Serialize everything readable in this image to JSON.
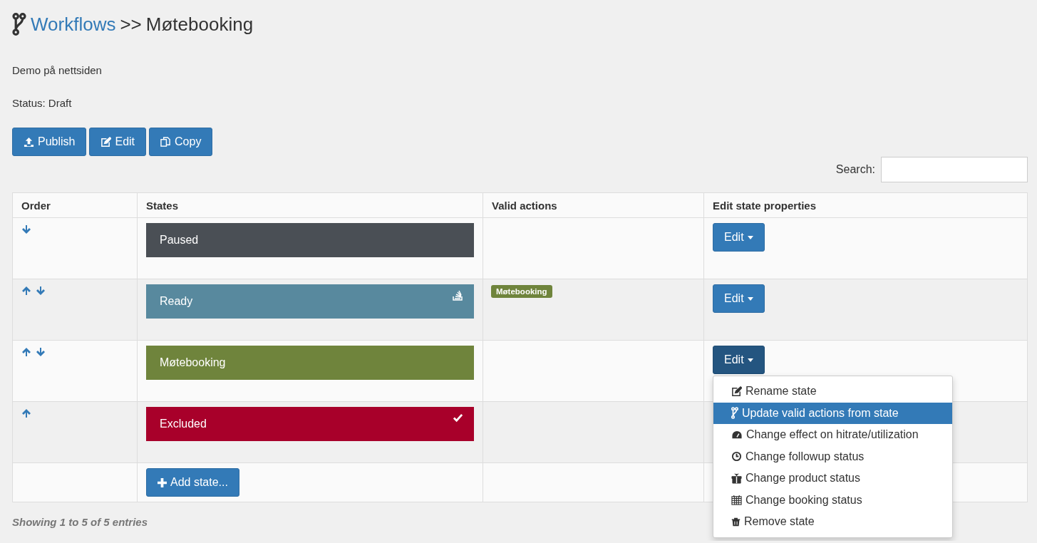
{
  "header": {
    "link": "Workflows",
    "separator": ">>",
    "title": "Møtebooking"
  },
  "description": "Demo på nettsiden",
  "status": "Status: Draft",
  "actions": [
    "Publish",
    "Edit",
    "Copy"
  ],
  "search": {
    "label": "Search:"
  },
  "table": {
    "columns": [
      "Order",
      "States",
      "Valid actions",
      "Edit state properties"
    ],
    "rows": [
      {
        "up": false,
        "down": true,
        "state": "Paused",
        "color": "#4a4f55",
        "kind": "plain",
        "actions": [],
        "edit": "Edit",
        "open": false
      },
      {
        "up": true,
        "down": true,
        "state": "Ready",
        "color": "#58899e",
        "kind": "start",
        "actions": [
          {
            "label": "Møtebooking",
            "color": "#6f843c"
          }
        ],
        "edit": "Edit",
        "open": false
      },
      {
        "up": true,
        "down": true,
        "state": "Møtebooking",
        "color": "#6f843c",
        "kind": "plain",
        "actions": [],
        "edit": "Edit",
        "open": true
      },
      {
        "up": true,
        "down": false,
        "state": "Excluded",
        "color": "#a8002a",
        "kind": "final",
        "actions": [],
        "open": false
      }
    ],
    "add_button": "Add state..."
  },
  "menu": [
    {
      "label": "Rename state",
      "selected": false
    },
    {
      "label": "Update valid actions from state",
      "selected": true
    },
    {
      "label": "Change effect on hitrate/utilization",
      "selected": false
    },
    {
      "label": "Change followup status",
      "selected": false
    },
    {
      "label": "Change product status",
      "selected": false
    },
    {
      "label": "Change booking status",
      "selected": false
    },
    {
      "label": "Remove state",
      "selected": false
    }
  ],
  "footer": "Showing 1 to 5 of 5 entries"
}
